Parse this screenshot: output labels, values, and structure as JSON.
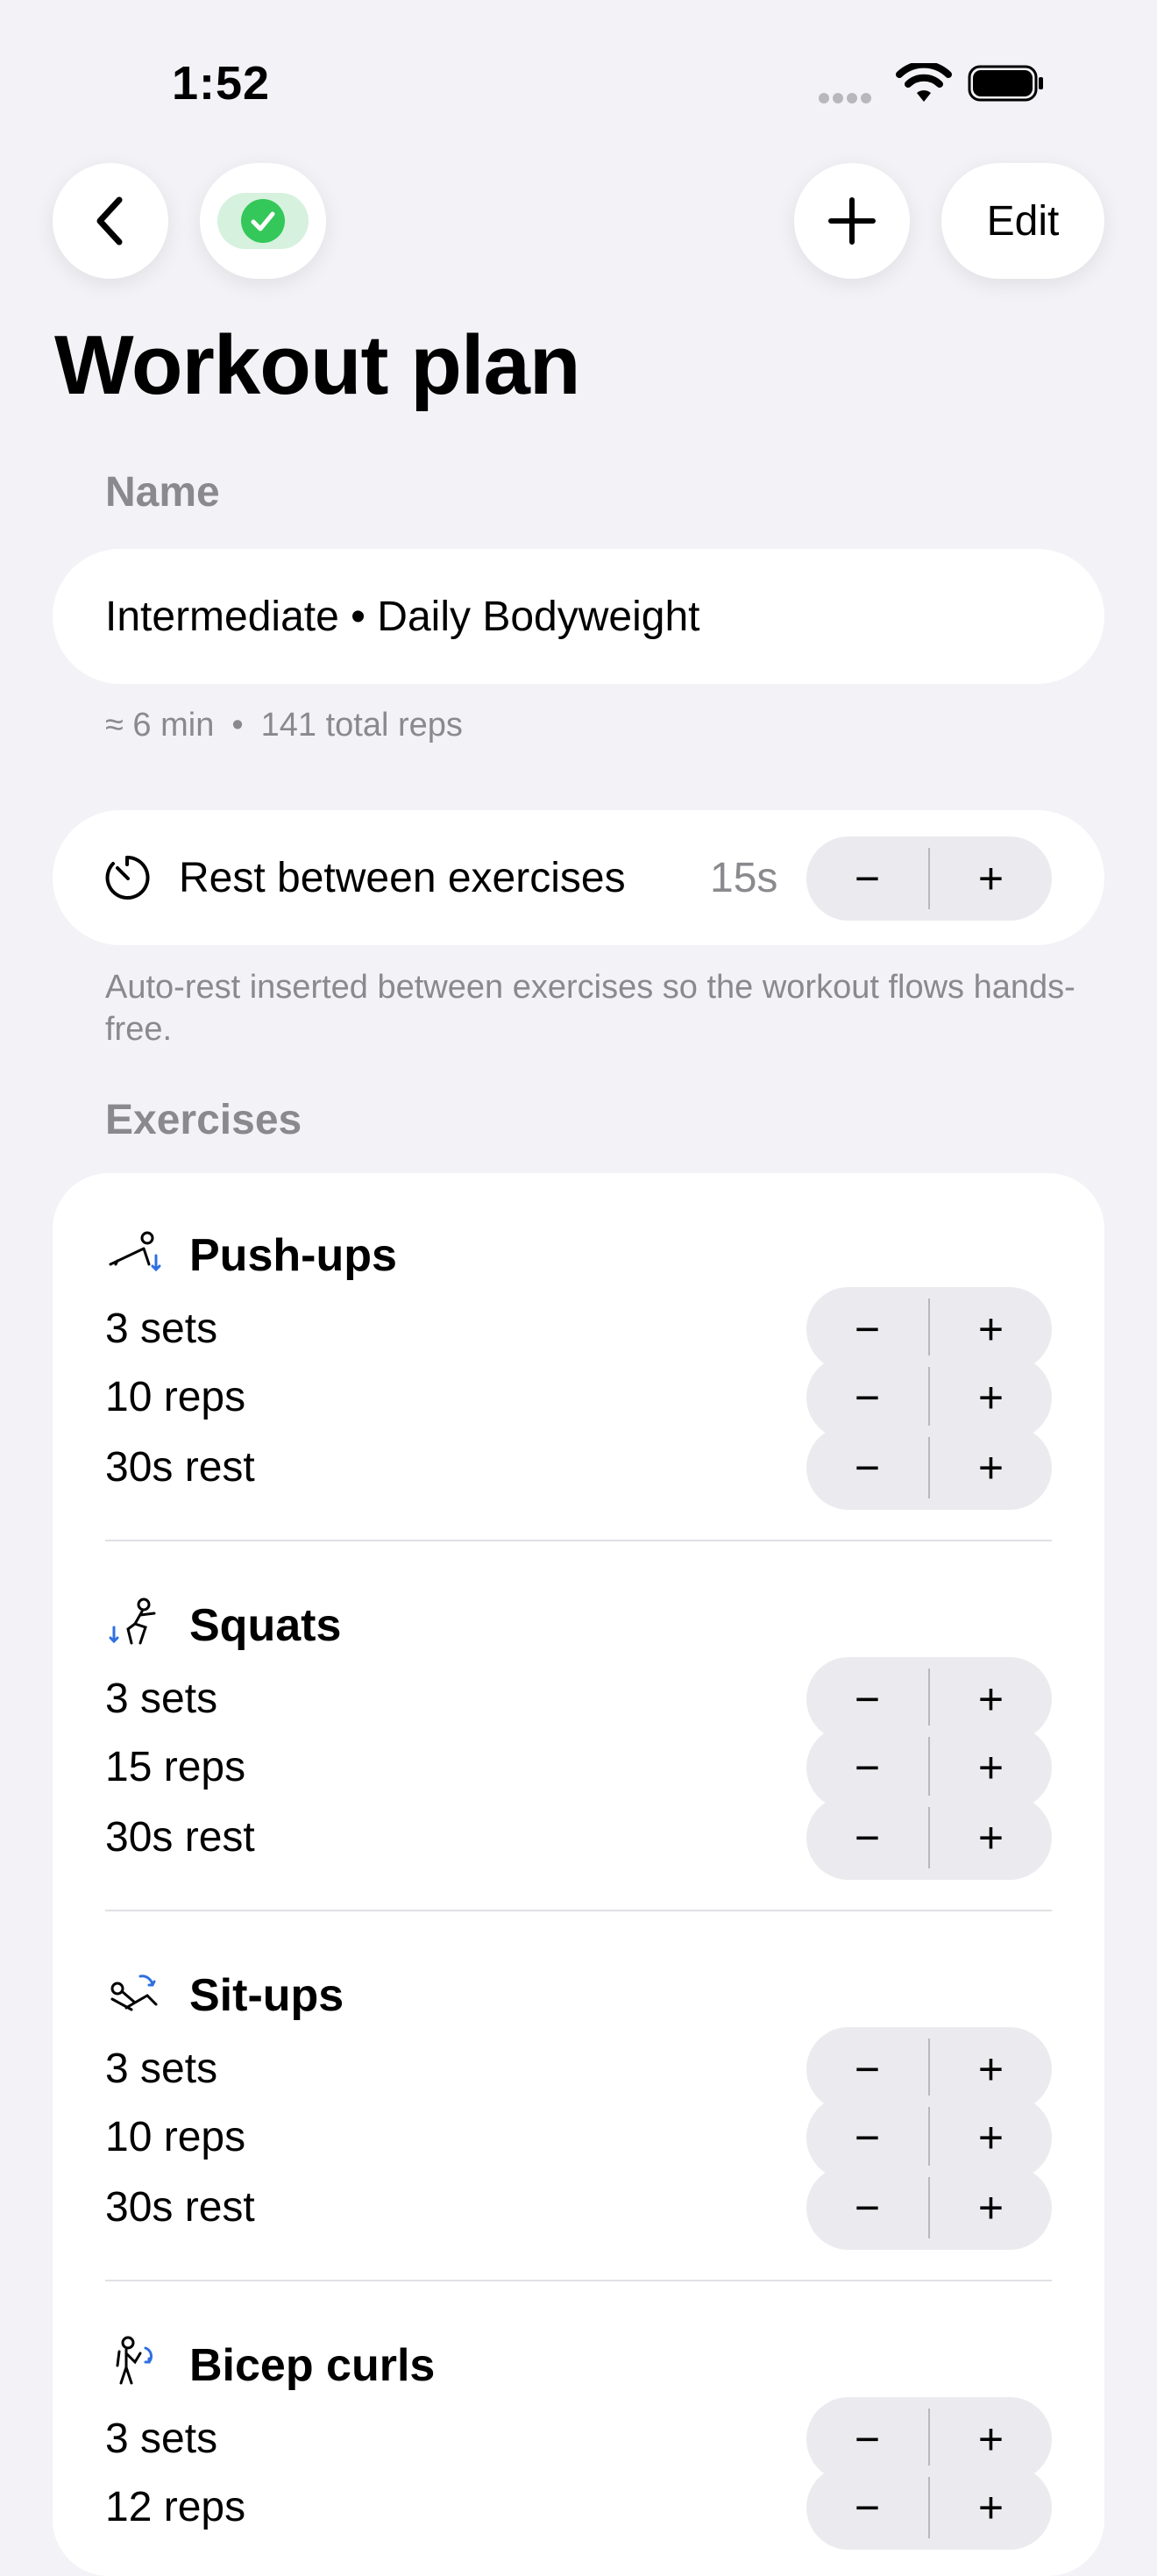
{
  "status": {
    "time": "1:52"
  },
  "nav": {
    "edit_label": "Edit"
  },
  "page": {
    "title": "Workout plan"
  },
  "name_section": {
    "label": "Name",
    "value": "Intermediate • Daily Bodyweight",
    "duration": "≈ 6 min",
    "separator": "•",
    "total_reps": "141 total reps"
  },
  "rest": {
    "label": "Rest between exercises",
    "value": "15s",
    "hint": "Auto-rest inserted between exercises so the workout flows hands-free."
  },
  "exercises_section": {
    "label": "Exercises",
    "items": [
      {
        "name": "Push-ups",
        "icon": "pushup-icon",
        "sets": "3 sets",
        "reps": "10 reps",
        "rest": "30s rest"
      },
      {
        "name": "Squats",
        "icon": "squat-icon",
        "sets": "3 sets",
        "reps": "15 reps",
        "rest": "30s rest"
      },
      {
        "name": "Sit-ups",
        "icon": "situp-icon",
        "sets": "3 sets",
        "reps": "10 reps",
        "rest": "30s rest"
      },
      {
        "name": "Bicep curls",
        "icon": "bicep-curl-icon",
        "sets": "3 sets",
        "reps": "12 reps",
        "rest": ""
      }
    ]
  },
  "stepper": {
    "minus": "−",
    "plus": "+"
  },
  "colors": {
    "background": "#f2f2f7",
    "accent_green": "#34c759",
    "secondary_text": "#8a8a8e",
    "icon_blue": "#2f6fe0"
  }
}
